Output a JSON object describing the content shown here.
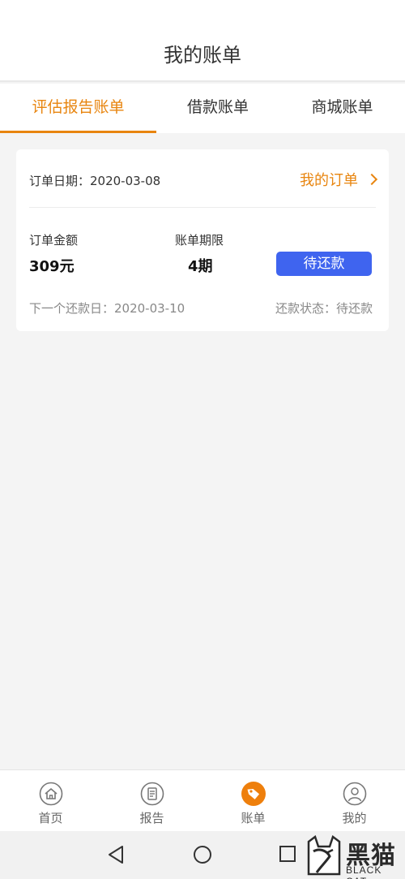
{
  "header": {
    "title": "我的账单"
  },
  "tabs": [
    {
      "label": "评估报告账单",
      "active": true
    },
    {
      "label": "借款账单",
      "active": false
    },
    {
      "label": "商城账单",
      "active": false
    }
  ],
  "bill": {
    "order_date": "订单日期：2020-03-08",
    "my_order_link": "我的订单",
    "amount_label": "订单金额",
    "amount_value": "309元",
    "period_label": "账单期限",
    "period_value": "4期",
    "pay_button": "待还款",
    "next_due": "下一个还款日：2020-03-10",
    "status": "还款状态：待还款"
  },
  "bottom_nav": [
    {
      "label": "首页",
      "icon": "home-icon"
    },
    {
      "label": "报告",
      "icon": "report-icon"
    },
    {
      "label": "账单",
      "icon": "bill-tag-icon",
      "active": true
    },
    {
      "label": "我的",
      "icon": "user-icon"
    }
  ],
  "watermark": {
    "cn": "黑猫",
    "en": "BLACK CAT"
  },
  "colors": {
    "accent": "#e8850f",
    "button_blue": "#3f64ef",
    "background": "#f4f4f4"
  }
}
